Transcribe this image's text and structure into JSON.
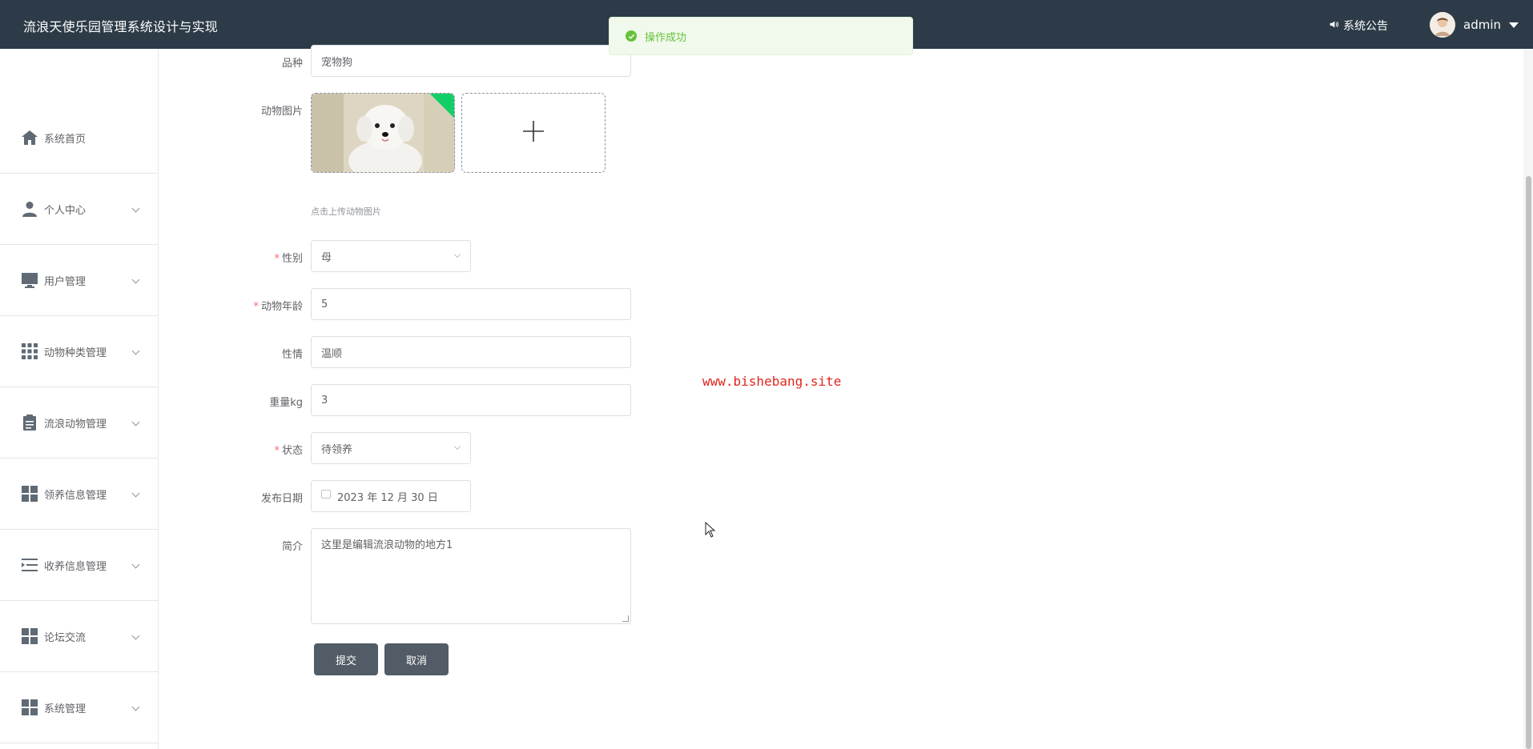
{
  "header": {
    "title": "流浪天使乐园管理系统设计与实现",
    "notice": "系统公告",
    "username": "admin"
  },
  "toast": {
    "message": "操作成功"
  },
  "sidebar": {
    "items": [
      {
        "label": "系统首页",
        "icon": "home-icon"
      },
      {
        "label": "个人中心",
        "icon": "user-icon"
      },
      {
        "label": "用户管理",
        "icon": "monitor-icon"
      },
      {
        "label": "动物种类管理",
        "icon": "grid-icon"
      },
      {
        "label": "流浪动物管理",
        "icon": "clipboard-icon"
      },
      {
        "label": "领养信息管理",
        "icon": "tiles-icon"
      },
      {
        "label": "收养信息管理",
        "icon": "list-icon"
      },
      {
        "label": "论坛交流",
        "icon": "tiles-icon"
      },
      {
        "label": "系统管理",
        "icon": "tiles-icon"
      }
    ]
  },
  "form": {
    "breed": {
      "label": "品种",
      "value": "宠物狗"
    },
    "image": {
      "label": "动物图片",
      "tip": "点击上传动物图片"
    },
    "gender": {
      "label": "性别",
      "value": "母",
      "required": true
    },
    "age": {
      "label": "动物年龄",
      "value": "5",
      "required": true
    },
    "temper": {
      "label": "性情",
      "value": "温顺"
    },
    "weight": {
      "label": "重量kg",
      "value": "3"
    },
    "status": {
      "label": "状态",
      "value": "待领养",
      "required": true
    },
    "date": {
      "label": "发布日期",
      "value": "2023 年 12 月 30 日"
    },
    "intro": {
      "label": "简介",
      "value": "这里是编辑流浪动物的地方1"
    },
    "submit": "提交",
    "cancel": "取消"
  },
  "watermark": "www.bishebang.site",
  "colors": {
    "header": "#2c3b47",
    "button": "#525c66",
    "success": "#67c23a",
    "watermark": "#e0251d"
  }
}
